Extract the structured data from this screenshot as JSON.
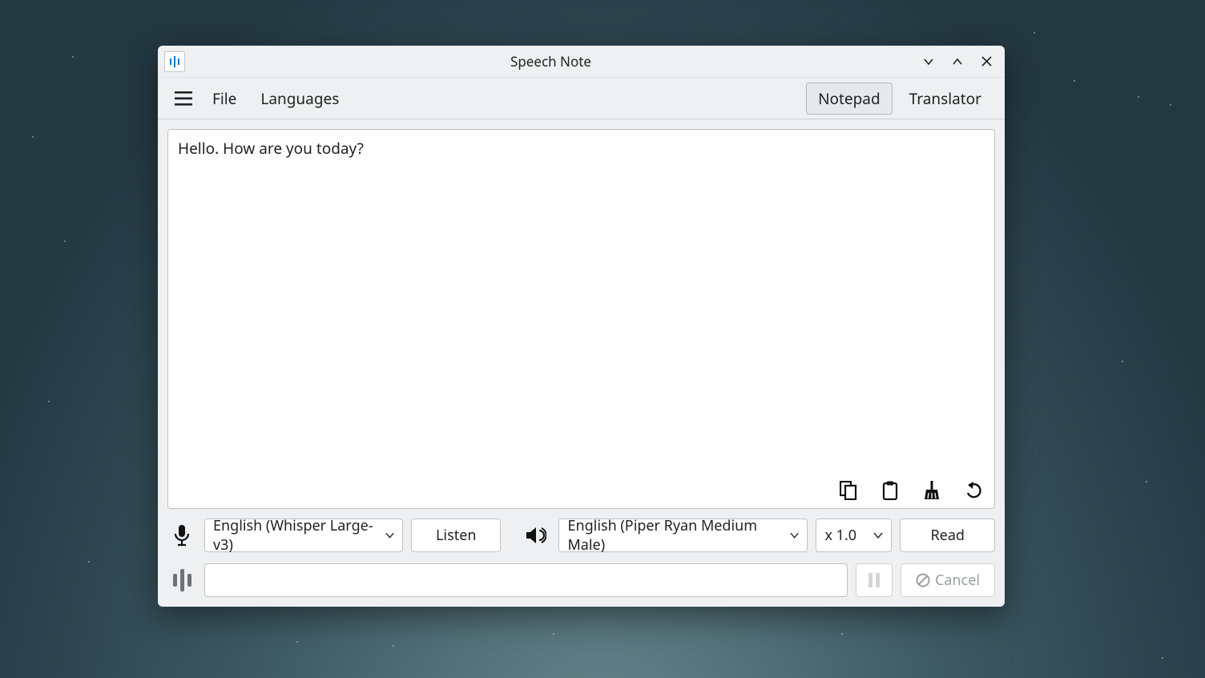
{
  "window": {
    "title": "Speech Note"
  },
  "menu": {
    "file": "File",
    "languages": "Languages"
  },
  "tabs": {
    "notepad": "Notepad",
    "translator": "Translator",
    "active": "notepad"
  },
  "note": {
    "text": "Hello. How are you today?"
  },
  "stt": {
    "model": "English (Whisper Large-v3)",
    "listen_label": "Listen"
  },
  "tts": {
    "voice": "English (Piper Ryan Medium Male)",
    "speed": "x 1.0",
    "read_label": "Read"
  },
  "controls": {
    "cancel_label": "Cancel"
  }
}
